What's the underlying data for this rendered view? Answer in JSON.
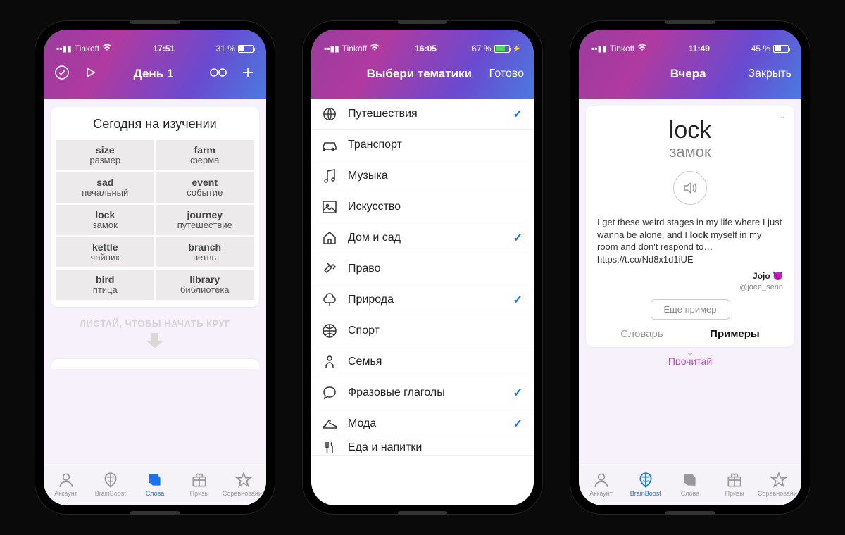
{
  "screen1": {
    "status": {
      "carrier": "Tinkoff",
      "time": "17:51",
      "battery_text": "31 %",
      "battery_pct": 31,
      "charging": false
    },
    "nav": {
      "title": "День 1"
    },
    "card_title": "Сегодня на изучении",
    "words": [
      {
        "en": "size",
        "ru": "размер"
      },
      {
        "en": "farm",
        "ru": "ферма"
      },
      {
        "en": "sad",
        "ru": "печальный"
      },
      {
        "en": "event",
        "ru": "событие"
      },
      {
        "en": "lock",
        "ru": "замок"
      },
      {
        "en": "journey",
        "ru": "путешествие"
      },
      {
        "en": "kettle",
        "ru": "чайник"
      },
      {
        "en": "branch",
        "ru": "ветвь"
      },
      {
        "en": "bird",
        "ru": "птица"
      },
      {
        "en": "library",
        "ru": "библиотека"
      }
    ],
    "swipe_hint": "ЛИСТАЙ, ЧТОБЫ НАЧАТЬ КРУГ",
    "tabs": [
      {
        "label": "Аккаунт",
        "active": false
      },
      {
        "label": "BrainBoost",
        "active": false
      },
      {
        "label": "Слова",
        "active": true
      },
      {
        "label": "Призы",
        "active": false
      },
      {
        "label": "Соревнования",
        "active": false
      }
    ]
  },
  "screen2": {
    "status": {
      "carrier": "Tinkoff",
      "time": "16:05",
      "battery_text": "67 %",
      "battery_pct": 67,
      "charging": true
    },
    "nav": {
      "title": "Выбери тематики",
      "done": "Готово"
    },
    "topics": [
      {
        "label": "Путешествия",
        "checked": true,
        "icon": "globe"
      },
      {
        "label": "Транспорт",
        "checked": false,
        "icon": "car"
      },
      {
        "label": "Музыка",
        "checked": false,
        "icon": "music"
      },
      {
        "label": "Искусство",
        "checked": false,
        "icon": "image"
      },
      {
        "label": "Дом и сад",
        "checked": true,
        "icon": "home"
      },
      {
        "label": "Право",
        "checked": false,
        "icon": "gavel"
      },
      {
        "label": "Природа",
        "checked": true,
        "icon": "tree"
      },
      {
        "label": "Спорт",
        "checked": false,
        "icon": "ball"
      },
      {
        "label": "Семья",
        "checked": false,
        "icon": "baby"
      },
      {
        "label": "Фразовые глаголы",
        "checked": true,
        "icon": "speech"
      },
      {
        "label": "Мода",
        "checked": true,
        "icon": "shoe"
      },
      {
        "label": "Еда и напитки",
        "checked": false,
        "icon": "food"
      }
    ]
  },
  "screen3": {
    "status": {
      "carrier": "Tinkoff",
      "time": "11:49",
      "battery_text": "45 %",
      "battery_pct": 45,
      "charging": false
    },
    "nav": {
      "title": "Вчера",
      "close": "Закрыть"
    },
    "word_en": "lock",
    "word_ru": "замок",
    "example_pre": "I get these weird stages in my life where I just wanna be alone, and I ",
    "example_bold": "lock",
    "example_post": " myself in my room and don't respond to… https://t.co/Nd8x1d1iUE",
    "author_name": "Jojo 😈",
    "author_handle": "@joee_senn",
    "more_btn": "Еще пример",
    "seg_dict": "Словарь",
    "seg_ex": "Примеры",
    "read_hint": "Прочитай",
    "tabs": [
      {
        "label": "Аккаунт",
        "active": false
      },
      {
        "label": "BrainBoost",
        "active": true
      },
      {
        "label": "Слова",
        "active": false
      },
      {
        "label": "Призы",
        "active": false
      },
      {
        "label": "Соревнования",
        "active": false
      }
    ]
  }
}
